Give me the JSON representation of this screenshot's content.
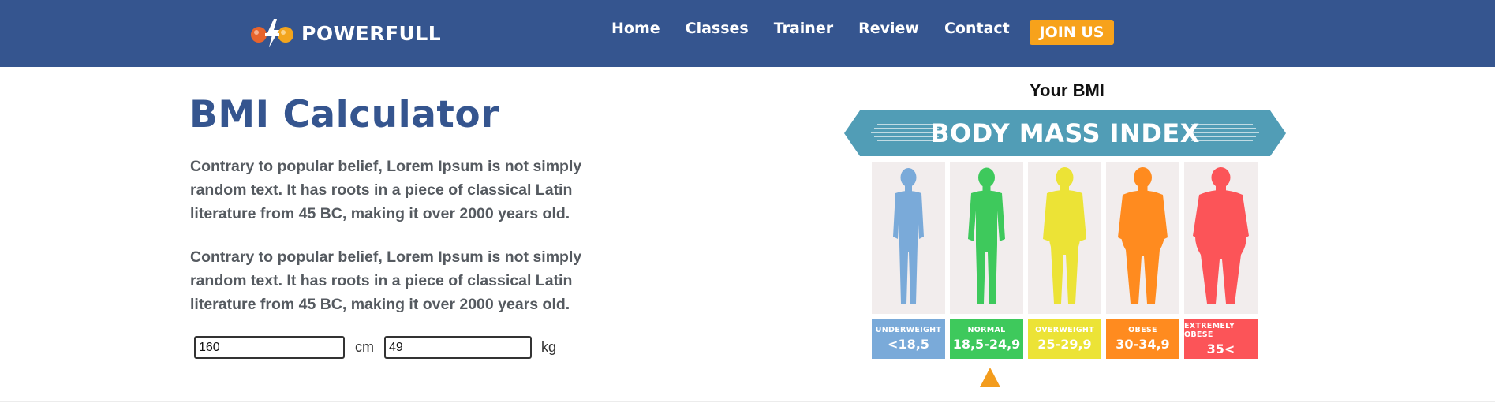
{
  "brand": {
    "name": "POWERFULL"
  },
  "nav": {
    "items": [
      "Home",
      "Classes",
      "Trainer",
      "Review",
      "Contact"
    ],
    "cta": "JOIN US"
  },
  "main": {
    "title": "BMI Calculator",
    "paragraphs": [
      "Contrary to popular belief, Lorem Ipsum is not simply random text. It has roots in a piece of classical Latin literature from 45 BC, making it over 2000 years old.",
      "Contrary to popular belief, Lorem Ipsum is not simply random text. It has roots in a piece of classical Latin literature from 45 BC, making it over 2000 years old."
    ],
    "height": {
      "value": "160",
      "unit": "cm"
    },
    "weight": {
      "value": "49",
      "unit": "kg"
    }
  },
  "bmi": {
    "heading": "Your BMI",
    "banner": "BODY MASS INDEX",
    "categories": [
      {
        "name": "UNDERWEIGHT",
        "range": "<18,5",
        "color": "#7aaad9"
      },
      {
        "name": "NORMAL",
        "range": "18,5-24,9",
        "color": "#3ec95c"
      },
      {
        "name": "OVERWEIGHT",
        "range": "25-29,9",
        "color": "#ece336"
      },
      {
        "name": "OBESE",
        "range": "30-34,9",
        "color": "#ff8b1f"
      },
      {
        "name": "EXTREMELY OBESE",
        "range": "35<",
        "color": "#fc5458"
      }
    ],
    "indicator": "NORMAL"
  },
  "colors": {
    "header": "#35558f",
    "accent": "#f7a21b",
    "banner": "#519db6",
    "indicator": "#f39c1d"
  }
}
